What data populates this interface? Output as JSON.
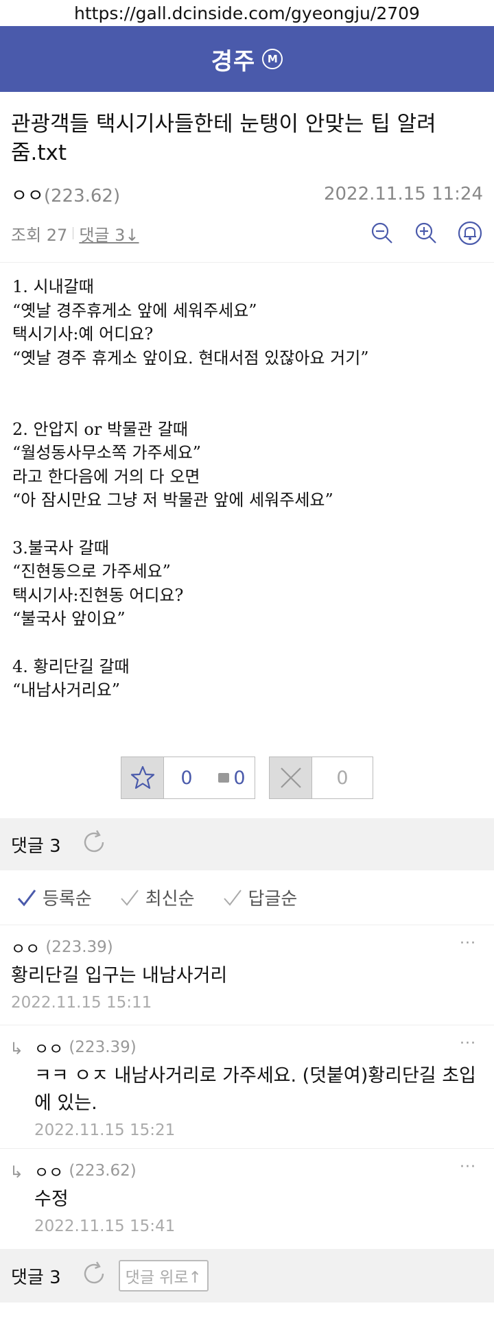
{
  "browser": {
    "url": "https://gall.dcinside.com/gyeongju/2709"
  },
  "header": {
    "title": "경주",
    "badge": "M",
    "color": "#4a5aab"
  },
  "post": {
    "title": "관광객들 택시기사들한테 눈탱이 안맞는 팁 알려줌.txt",
    "author": "ㅇㅇ",
    "ip": "(223.62)",
    "datetime": "2022.11.15 11:24",
    "views": "조회 27",
    "comments_link": "댓글 3↓",
    "content_lines": [
      "1. 시내갈때",
      "“옛날 경주휴게소 앞에 세워주세요”",
      "택시기사:예 어디요?",
      "“옛날 경주 휴게소 앞이요. 현대서점 있잖아요 거기”",
      "",
      "",
      "2. 안압지 or 박물관 갈때",
      "“월성동사무소쪽 가주세요”",
      "라고 한다음에 거의 다 오면",
      "“아 잠시만요 그냥 저 박물관 앞에 세워주세요”",
      "",
      "3.불국사 갈때",
      "“진현동으로 가주세요”",
      "택시기사:진현동 어디요?",
      "“불국사 앞이요”",
      "",
      "4. 황리단길 갈때",
      "“내남사거리요”"
    ]
  },
  "votes": {
    "up": "0",
    "fixed_up": "0",
    "down": "0"
  },
  "comments_bar": {
    "label": "댓글 3"
  },
  "sort": {
    "registered": "등록순",
    "latest": "최신순",
    "replies": "답글순"
  },
  "comments": [
    {
      "author": "ㅇㅇ",
      "ip": "(223.39)",
      "text": "황리단길 입구는 내남사거리",
      "date": "2022.11.15 15:11",
      "more": "···"
    },
    {
      "author": "ㅇㅇ",
      "ip": "(223.39)",
      "text": "ㅋㅋ ㅇㅈ 내남사거리로 가주세요. (덧붙여)황리단길 초입에 있는.",
      "date": "2022.11.15 15:21",
      "more": "···"
    },
    {
      "author": "ㅇㅇ",
      "ip": "(223.62)",
      "text": "수정",
      "date": "2022.11.15 15:41",
      "more": "···"
    }
  ],
  "reply_arrow": "↳",
  "bottom_bar": {
    "label": "댓글 3",
    "to_top": "댓글 위로↑"
  }
}
